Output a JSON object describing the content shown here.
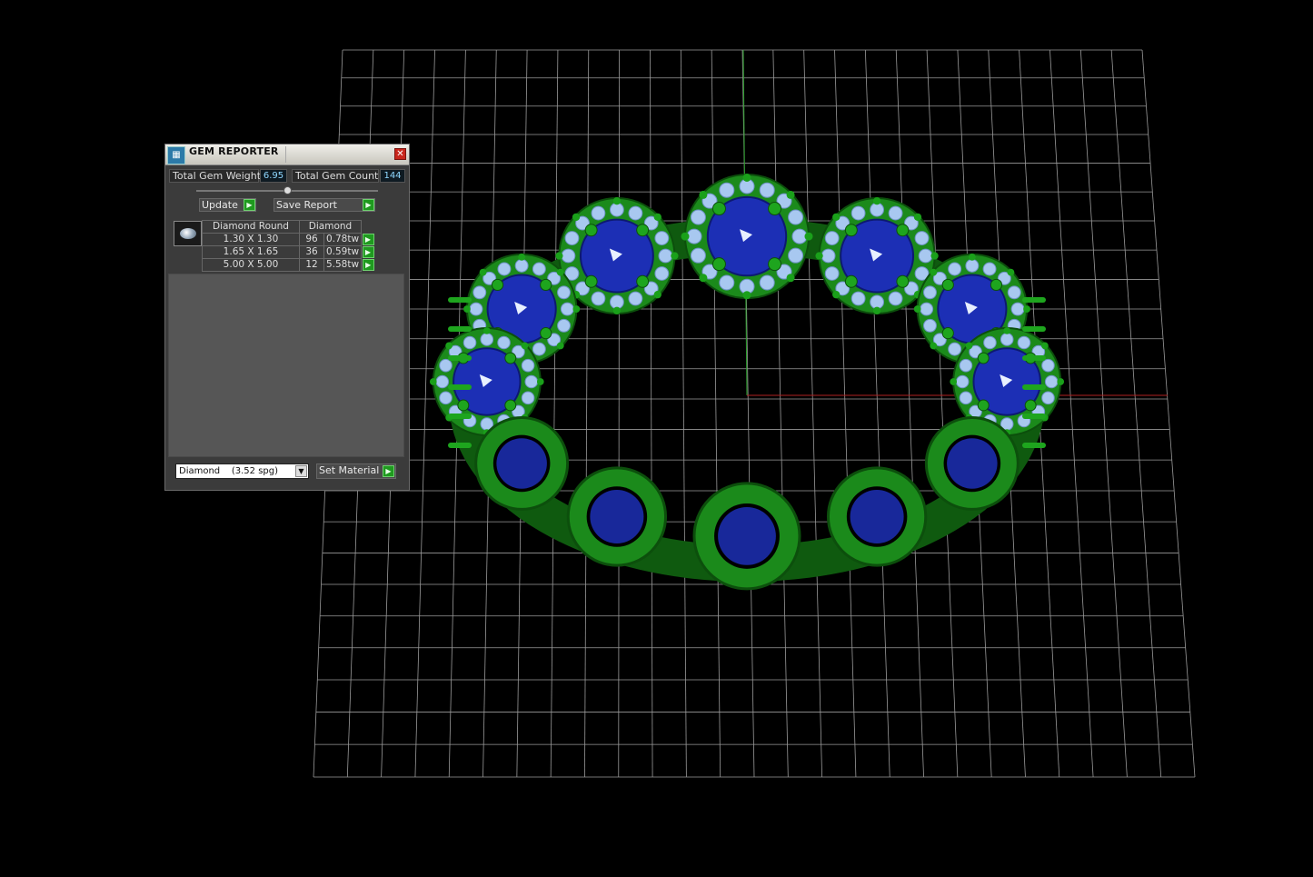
{
  "gem_reporter": {
    "title": "GEM REPORTER",
    "close_glyph": "✕",
    "total_gem_weight_label": "Total Gem Weight",
    "total_gem_weight": "6.95",
    "total_gem_count_label": "Total Gem Count",
    "total_gem_count": "144",
    "update_label": "Update",
    "save_report_label": "Save Report",
    "table_header": {
      "cut": "Diamond Round",
      "material": "Diamond"
    },
    "rows": [
      {
        "size": "1.30 X 1.30",
        "count": "96",
        "weight": "0.78tw"
      },
      {
        "size": "1.65 X 1.65",
        "count": "36",
        "weight": "0.59tw"
      },
      {
        "size": "5.00 X 5.00",
        "count": "12",
        "weight": "5.58tw"
      }
    ],
    "material_select": "Diamond    (3.52 spg)",
    "set_material_label": "Set Material"
  },
  "colors": {
    "metal": "#1b8a1b",
    "center_stone": "#1c2fb5",
    "accent_stone": "#a8c8f0",
    "grid": "#9a9a9a",
    "axis_green": "#2ea02e",
    "axis_red": "#b02020"
  },
  "icons": {
    "logo": "gem-reporter-logo-icon",
    "close": "close-icon",
    "play": "play-arrow-icon",
    "dropdown": "chevron-down-icon"
  }
}
